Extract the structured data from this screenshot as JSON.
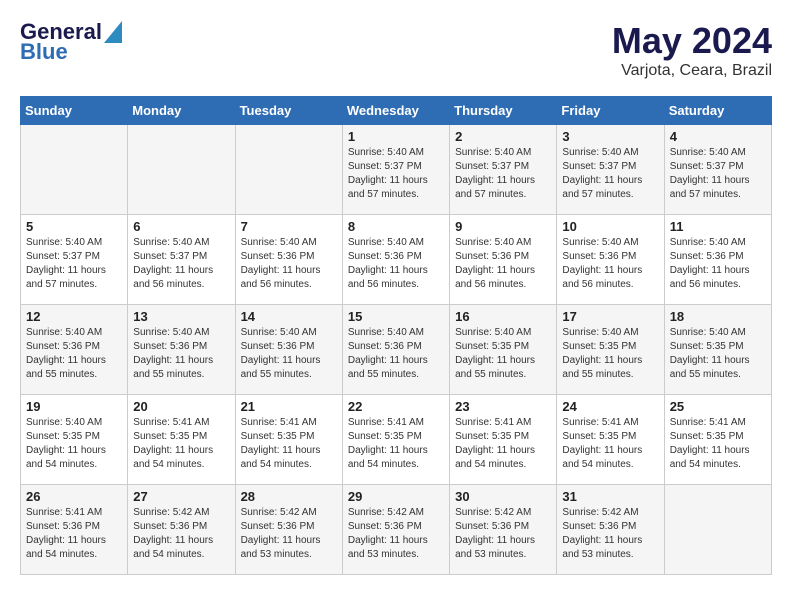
{
  "logo": {
    "line1": "General",
    "line2": "Blue"
  },
  "title": "May 2024",
  "location": "Varjota, Ceara, Brazil",
  "days_of_week": [
    "Sunday",
    "Monday",
    "Tuesday",
    "Wednesday",
    "Thursday",
    "Friday",
    "Saturday"
  ],
  "weeks": [
    [
      {
        "day": "",
        "info": ""
      },
      {
        "day": "",
        "info": ""
      },
      {
        "day": "",
        "info": ""
      },
      {
        "day": "1",
        "info": "Sunrise: 5:40 AM\nSunset: 5:37 PM\nDaylight: 11 hours\nand 57 minutes."
      },
      {
        "day": "2",
        "info": "Sunrise: 5:40 AM\nSunset: 5:37 PM\nDaylight: 11 hours\nand 57 minutes."
      },
      {
        "day": "3",
        "info": "Sunrise: 5:40 AM\nSunset: 5:37 PM\nDaylight: 11 hours\nand 57 minutes."
      },
      {
        "day": "4",
        "info": "Sunrise: 5:40 AM\nSunset: 5:37 PM\nDaylight: 11 hours\nand 57 minutes."
      }
    ],
    [
      {
        "day": "5",
        "info": "Sunrise: 5:40 AM\nSunset: 5:37 PM\nDaylight: 11 hours\nand 57 minutes."
      },
      {
        "day": "6",
        "info": "Sunrise: 5:40 AM\nSunset: 5:37 PM\nDaylight: 11 hours\nand 56 minutes."
      },
      {
        "day": "7",
        "info": "Sunrise: 5:40 AM\nSunset: 5:36 PM\nDaylight: 11 hours\nand 56 minutes."
      },
      {
        "day": "8",
        "info": "Sunrise: 5:40 AM\nSunset: 5:36 PM\nDaylight: 11 hours\nand 56 minutes."
      },
      {
        "day": "9",
        "info": "Sunrise: 5:40 AM\nSunset: 5:36 PM\nDaylight: 11 hours\nand 56 minutes."
      },
      {
        "day": "10",
        "info": "Sunrise: 5:40 AM\nSunset: 5:36 PM\nDaylight: 11 hours\nand 56 minutes."
      },
      {
        "day": "11",
        "info": "Sunrise: 5:40 AM\nSunset: 5:36 PM\nDaylight: 11 hours\nand 56 minutes."
      }
    ],
    [
      {
        "day": "12",
        "info": "Sunrise: 5:40 AM\nSunset: 5:36 PM\nDaylight: 11 hours\nand 55 minutes."
      },
      {
        "day": "13",
        "info": "Sunrise: 5:40 AM\nSunset: 5:36 PM\nDaylight: 11 hours\nand 55 minutes."
      },
      {
        "day": "14",
        "info": "Sunrise: 5:40 AM\nSunset: 5:36 PM\nDaylight: 11 hours\nand 55 minutes."
      },
      {
        "day": "15",
        "info": "Sunrise: 5:40 AM\nSunset: 5:36 PM\nDaylight: 11 hours\nand 55 minutes."
      },
      {
        "day": "16",
        "info": "Sunrise: 5:40 AM\nSunset: 5:35 PM\nDaylight: 11 hours\nand 55 minutes."
      },
      {
        "day": "17",
        "info": "Sunrise: 5:40 AM\nSunset: 5:35 PM\nDaylight: 11 hours\nand 55 minutes."
      },
      {
        "day": "18",
        "info": "Sunrise: 5:40 AM\nSunset: 5:35 PM\nDaylight: 11 hours\nand 55 minutes."
      }
    ],
    [
      {
        "day": "19",
        "info": "Sunrise: 5:40 AM\nSunset: 5:35 PM\nDaylight: 11 hours\nand 54 minutes."
      },
      {
        "day": "20",
        "info": "Sunrise: 5:41 AM\nSunset: 5:35 PM\nDaylight: 11 hours\nand 54 minutes."
      },
      {
        "day": "21",
        "info": "Sunrise: 5:41 AM\nSunset: 5:35 PM\nDaylight: 11 hours\nand 54 minutes."
      },
      {
        "day": "22",
        "info": "Sunrise: 5:41 AM\nSunset: 5:35 PM\nDaylight: 11 hours\nand 54 minutes."
      },
      {
        "day": "23",
        "info": "Sunrise: 5:41 AM\nSunset: 5:35 PM\nDaylight: 11 hours\nand 54 minutes."
      },
      {
        "day": "24",
        "info": "Sunrise: 5:41 AM\nSunset: 5:35 PM\nDaylight: 11 hours\nand 54 minutes."
      },
      {
        "day": "25",
        "info": "Sunrise: 5:41 AM\nSunset: 5:35 PM\nDaylight: 11 hours\nand 54 minutes."
      }
    ],
    [
      {
        "day": "26",
        "info": "Sunrise: 5:41 AM\nSunset: 5:36 PM\nDaylight: 11 hours\nand 54 minutes."
      },
      {
        "day": "27",
        "info": "Sunrise: 5:42 AM\nSunset: 5:36 PM\nDaylight: 11 hours\nand 54 minutes."
      },
      {
        "day": "28",
        "info": "Sunrise: 5:42 AM\nSunset: 5:36 PM\nDaylight: 11 hours\nand 53 minutes."
      },
      {
        "day": "29",
        "info": "Sunrise: 5:42 AM\nSunset: 5:36 PM\nDaylight: 11 hours\nand 53 minutes."
      },
      {
        "day": "30",
        "info": "Sunrise: 5:42 AM\nSunset: 5:36 PM\nDaylight: 11 hours\nand 53 minutes."
      },
      {
        "day": "31",
        "info": "Sunrise: 5:42 AM\nSunset: 5:36 PM\nDaylight: 11 hours\nand 53 minutes."
      },
      {
        "day": "",
        "info": ""
      }
    ]
  ]
}
